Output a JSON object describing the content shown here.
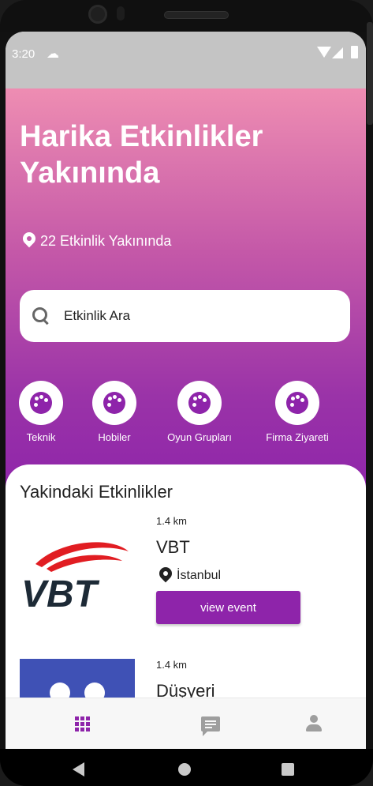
{
  "status_bar": {
    "time": "3:20"
  },
  "hero": {
    "title": "Harika Etkinlikler Yakınında",
    "nearby_count_text": "22 Etkinlik Yakınında"
  },
  "search": {
    "placeholder": "Etkinlik Ara"
  },
  "categories": [
    {
      "label": "Teknik",
      "icon": "palette-icon"
    },
    {
      "label": "Hobiler",
      "icon": "palette-icon"
    },
    {
      "label": "Oyun Grupları",
      "icon": "palette-icon"
    },
    {
      "label": "Firma Ziyareti",
      "icon": "palette-icon"
    }
  ],
  "events_section": {
    "title": "Yakindaki Etkinlikler",
    "events": [
      {
        "distance": "1.4 km",
        "name": "VBT",
        "location": "İstanbul",
        "button_label": "view event",
        "logo_text": "VBT"
      },
      {
        "distance": "1.4 km",
        "name": "Düşyeri"
      }
    ]
  },
  "bottom_nav": {
    "items": [
      {
        "icon": "grid-icon",
        "active": true
      },
      {
        "icon": "chat-icon",
        "active": false
      },
      {
        "icon": "person-icon",
        "active": false
      }
    ]
  },
  "colors": {
    "accent": "#8e24aa",
    "gradient_top": "#ee8db2",
    "gradient_bottom": "#8e24aa",
    "logo_red": "#e11d22",
    "logo_dark": "#1d2a36",
    "duyseri_blue": "#3f51b5"
  }
}
